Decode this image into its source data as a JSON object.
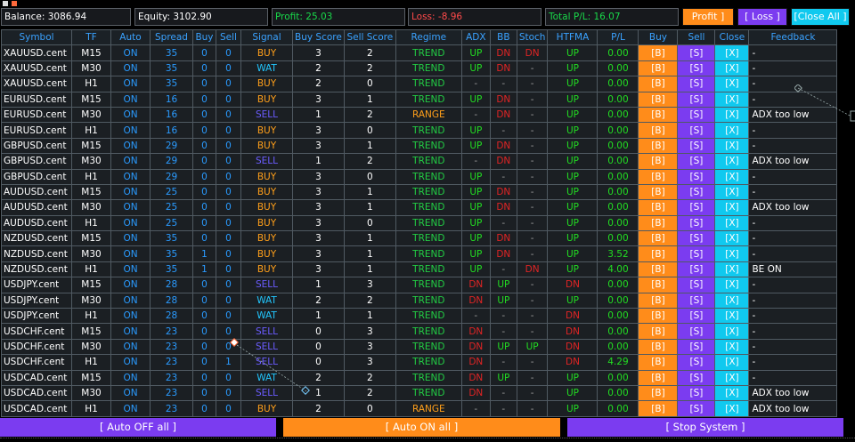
{
  "colors": {
    "buy": "#ff9f1a",
    "sell": "#6b5cff",
    "wait": "#22c7ff",
    "trend": "#22cc44",
    "range": "#ff9f1a",
    "up": "#22dd22",
    "dn": "#e02424",
    "dash": "#999999",
    "pl": "#22dd22",
    "profit_text": "#19d94a",
    "loss_text": "#ff4a4a",
    "total_text": "#19d94a",
    "profit_btn": "#ff8c1a",
    "loss_btn": "#7b3cf0",
    "closeall_btn": "#10c9ef"
  },
  "summary": {
    "balance": "Balance: 3086.94",
    "equity": "Equity: 3102.90",
    "profit": "Profit: 25.03",
    "loss": "Loss: -8.96",
    "total": "Total P/L: 16.07",
    "profit_button": "Profit ]",
    "loss_button": "[ Loss ]",
    "closeall_button": "[Close All ]"
  },
  "headers": [
    "Symbol",
    "TF",
    "Auto",
    "Spread",
    "Buy",
    "Sell",
    "Signal",
    "Buy Score",
    "Sell Score",
    "Regime",
    "ADX",
    "BB",
    "Stoch",
    "HTFMA",
    "P/L",
    "Buy",
    "Sell",
    "Close",
    "Feedback"
  ],
  "rows": [
    {
      "symbol": "XAUUSD.cent",
      "tf": "M15",
      "auto": "ON",
      "spread": "35",
      "buy": "0",
      "sell": "0",
      "signal": "BUY",
      "buy_score": "3",
      "sell_score": "2",
      "regime": "TREND",
      "adx": "UP",
      "bb": "DN",
      "stoch": "DN",
      "htfma": "UP",
      "pl": "0.00",
      "feedback": "-"
    },
    {
      "symbol": "XAUUSD.cent",
      "tf": "M30",
      "auto": "ON",
      "spread": "35",
      "buy": "0",
      "sell": "0",
      "signal": "WAT",
      "buy_score": "2",
      "sell_score": "2",
      "regime": "TREND",
      "adx": "UP",
      "bb": "DN",
      "stoch": "-",
      "htfma": "UP",
      "pl": "0.00",
      "feedback": "-"
    },
    {
      "symbol": "XAUUSD.cent",
      "tf": "H1",
      "auto": "ON",
      "spread": "35",
      "buy": "0",
      "sell": "0",
      "signal": "BUY",
      "buy_score": "2",
      "sell_score": "0",
      "regime": "TREND",
      "adx": "-",
      "bb": "-",
      "stoch": "-",
      "htfma": "UP",
      "pl": "0.00",
      "feedback": "-"
    },
    {
      "symbol": "EURUSD.cent",
      "tf": "M15",
      "auto": "ON",
      "spread": "16",
      "buy": "0",
      "sell": "0",
      "signal": "BUY",
      "buy_score": "3",
      "sell_score": "1",
      "regime": "TREND",
      "adx": "UP",
      "bb": "DN",
      "stoch": "-",
      "htfma": "UP",
      "pl": "0.00",
      "feedback": "-"
    },
    {
      "symbol": "EURUSD.cent",
      "tf": "M30",
      "auto": "ON",
      "spread": "16",
      "buy": "0",
      "sell": "0",
      "signal": "SELL",
      "buy_score": "1",
      "sell_score": "2",
      "regime": "RANGE",
      "adx": "-",
      "bb": "DN",
      "stoch": "-",
      "htfma": "UP",
      "pl": "0.00",
      "feedback": "ADX too low"
    },
    {
      "symbol": "EURUSD.cent",
      "tf": "H1",
      "auto": "ON",
      "spread": "16",
      "buy": "0",
      "sell": "0",
      "signal": "BUY",
      "buy_score": "3",
      "sell_score": "0",
      "regime": "TREND",
      "adx": "UP",
      "bb": "-",
      "stoch": "-",
      "htfma": "UP",
      "pl": "0.00",
      "feedback": "-"
    },
    {
      "symbol": "GBPUSD.cent",
      "tf": "M15",
      "auto": "ON",
      "spread": "29",
      "buy": "0",
      "sell": "0",
      "signal": "BUY",
      "buy_score": "3",
      "sell_score": "1",
      "regime": "TREND",
      "adx": "UP",
      "bb": "DN",
      "stoch": "-",
      "htfma": "UP",
      "pl": "0.00",
      "feedback": "-"
    },
    {
      "symbol": "GBPUSD.cent",
      "tf": "M30",
      "auto": "ON",
      "spread": "29",
      "buy": "0",
      "sell": "0",
      "signal": "SELL",
      "buy_score": "1",
      "sell_score": "2",
      "regime": "TREND",
      "adx": "-",
      "bb": "DN",
      "stoch": "-",
      "htfma": "UP",
      "pl": "0.00",
      "feedback": "ADX too low"
    },
    {
      "symbol": "GBPUSD.cent",
      "tf": "H1",
      "auto": "ON",
      "spread": "29",
      "buy": "0",
      "sell": "0",
      "signal": "BUY",
      "buy_score": "3",
      "sell_score": "0",
      "regime": "TREND",
      "adx": "UP",
      "bb": "-",
      "stoch": "-",
      "htfma": "UP",
      "pl": "0.00",
      "feedback": "-"
    },
    {
      "symbol": "AUDUSD.cent",
      "tf": "M15",
      "auto": "ON",
      "spread": "25",
      "buy": "0",
      "sell": "0",
      "signal": "BUY",
      "buy_score": "3",
      "sell_score": "1",
      "regime": "TREND",
      "adx": "UP",
      "bb": "DN",
      "stoch": "-",
      "htfma": "UP",
      "pl": "0.00",
      "feedback": "-"
    },
    {
      "symbol": "AUDUSD.cent",
      "tf": "M30",
      "auto": "ON",
      "spread": "25",
      "buy": "0",
      "sell": "0",
      "signal": "BUY",
      "buy_score": "3",
      "sell_score": "1",
      "regime": "TREND",
      "adx": "UP",
      "bb": "DN",
      "stoch": "-",
      "htfma": "UP",
      "pl": "0.00",
      "feedback": "ADX too low"
    },
    {
      "symbol": "AUDUSD.cent",
      "tf": "H1",
      "auto": "ON",
      "spread": "25",
      "buy": "0",
      "sell": "0",
      "signal": "BUY",
      "buy_score": "3",
      "sell_score": "0",
      "regime": "TREND",
      "adx": "UP",
      "bb": "-",
      "stoch": "-",
      "htfma": "UP",
      "pl": "0.00",
      "feedback": "-"
    },
    {
      "symbol": "NZDUSD.cent",
      "tf": "M15",
      "auto": "ON",
      "spread": "35",
      "buy": "0",
      "sell": "0",
      "signal": "BUY",
      "buy_score": "3",
      "sell_score": "1",
      "regime": "TREND",
      "adx": "UP",
      "bb": "DN",
      "stoch": "-",
      "htfma": "UP",
      "pl": "0.00",
      "feedback": "-"
    },
    {
      "symbol": "NZDUSD.cent",
      "tf": "M30",
      "auto": "ON",
      "spread": "35",
      "buy": "1",
      "sell": "0",
      "signal": "BUY",
      "buy_score": "3",
      "sell_score": "1",
      "regime": "TREND",
      "adx": "UP",
      "bb": "DN",
      "stoch": "-",
      "htfma": "UP",
      "pl": "3.52",
      "feedback": "-"
    },
    {
      "symbol": "NZDUSD.cent",
      "tf": "H1",
      "auto": "ON",
      "spread": "35",
      "buy": "1",
      "sell": "0",
      "signal": "BUY",
      "buy_score": "3",
      "sell_score": "1",
      "regime": "TREND",
      "adx": "UP",
      "bb": "-",
      "stoch": "DN",
      "htfma": "UP",
      "pl": "4.00",
      "feedback": "BE ON"
    },
    {
      "symbol": "USDJPY.cent",
      "tf": "M15",
      "auto": "ON",
      "spread": "28",
      "buy": "0",
      "sell": "0",
      "signal": "SELL",
      "buy_score": "1",
      "sell_score": "3",
      "regime": "TREND",
      "adx": "DN",
      "bb": "UP",
      "stoch": "-",
      "htfma": "DN",
      "pl": "0.00",
      "feedback": "-"
    },
    {
      "symbol": "USDJPY.cent",
      "tf": "M30",
      "auto": "ON",
      "spread": "28",
      "buy": "0",
      "sell": "0",
      "signal": "WAT",
      "buy_score": "2",
      "sell_score": "2",
      "regime": "TREND",
      "adx": "DN",
      "bb": "UP",
      "stoch": "-",
      "htfma": "UP",
      "pl": "0.00",
      "feedback": "-"
    },
    {
      "symbol": "USDJPY.cent",
      "tf": "H1",
      "auto": "ON",
      "spread": "28",
      "buy": "0",
      "sell": "0",
      "signal": "WAT",
      "buy_score": "1",
      "sell_score": "1",
      "regime": "TREND",
      "adx": "-",
      "bb": "-",
      "stoch": "-",
      "htfma": "DN",
      "pl": "0.00",
      "feedback": "-"
    },
    {
      "symbol": "USDCHF.cent",
      "tf": "M15",
      "auto": "ON",
      "spread": "23",
      "buy": "0",
      "sell": "0",
      "signal": "SELL",
      "buy_score": "0",
      "sell_score": "3",
      "regime": "TREND",
      "adx": "DN",
      "bb": "-",
      "stoch": "-",
      "htfma": "DN",
      "pl": "0.00",
      "feedback": "-"
    },
    {
      "symbol": "USDCHF.cent",
      "tf": "M30",
      "auto": "ON",
      "spread": "23",
      "buy": "0",
      "sell": "0",
      "signal": "SELL",
      "buy_score": "0",
      "sell_score": "3",
      "regime": "TREND",
      "adx": "DN",
      "bb": "UP",
      "stoch": "UP",
      "htfma": "DN",
      "pl": "0.00",
      "feedback": "-"
    },
    {
      "symbol": "USDCHF.cent",
      "tf": "H1",
      "auto": "ON",
      "spread": "23",
      "buy": "0",
      "sell": "1",
      "signal": "SELL",
      "buy_score": "0",
      "sell_score": "3",
      "regime": "TREND",
      "adx": "DN",
      "bb": "-",
      "stoch": "-",
      "htfma": "DN",
      "pl": "4.29",
      "feedback": "-"
    },
    {
      "symbol": "USDCAD.cent",
      "tf": "M15",
      "auto": "ON",
      "spread": "23",
      "buy": "0",
      "sell": "0",
      "signal": "WAT",
      "buy_score": "2",
      "sell_score": "2",
      "regime": "TREND",
      "adx": "DN",
      "bb": "UP",
      "stoch": "-",
      "htfma": "UP",
      "pl": "0.00",
      "feedback": "-"
    },
    {
      "symbol": "USDCAD.cent",
      "tf": "M30",
      "auto": "ON",
      "spread": "23",
      "buy": "0",
      "sell": "0",
      "signal": "SELL",
      "buy_score": "1",
      "sell_score": "2",
      "regime": "TREND",
      "adx": "DN",
      "bb": "-",
      "stoch": "-",
      "htfma": "UP",
      "pl": "0.00",
      "feedback": "ADX too low"
    },
    {
      "symbol": "USDCAD.cent",
      "tf": "H1",
      "auto": "ON",
      "spread": "23",
      "buy": "0",
      "sell": "0",
      "signal": "BUY",
      "buy_score": "2",
      "sell_score": "0",
      "regime": "RANGE",
      "adx": "-",
      "bb": "-",
      "stoch": "-",
      "htfma": "UP",
      "pl": "0.00",
      "feedback": "ADX too low"
    }
  ],
  "row_buttons": {
    "buy": "[B]",
    "sell": "[S]",
    "close": "[X]"
  },
  "bottom": {
    "auto_off": "[ Auto OFF all ]",
    "auto_on": "[ Auto ON all ]",
    "stop": "[ Stop System ]"
  }
}
